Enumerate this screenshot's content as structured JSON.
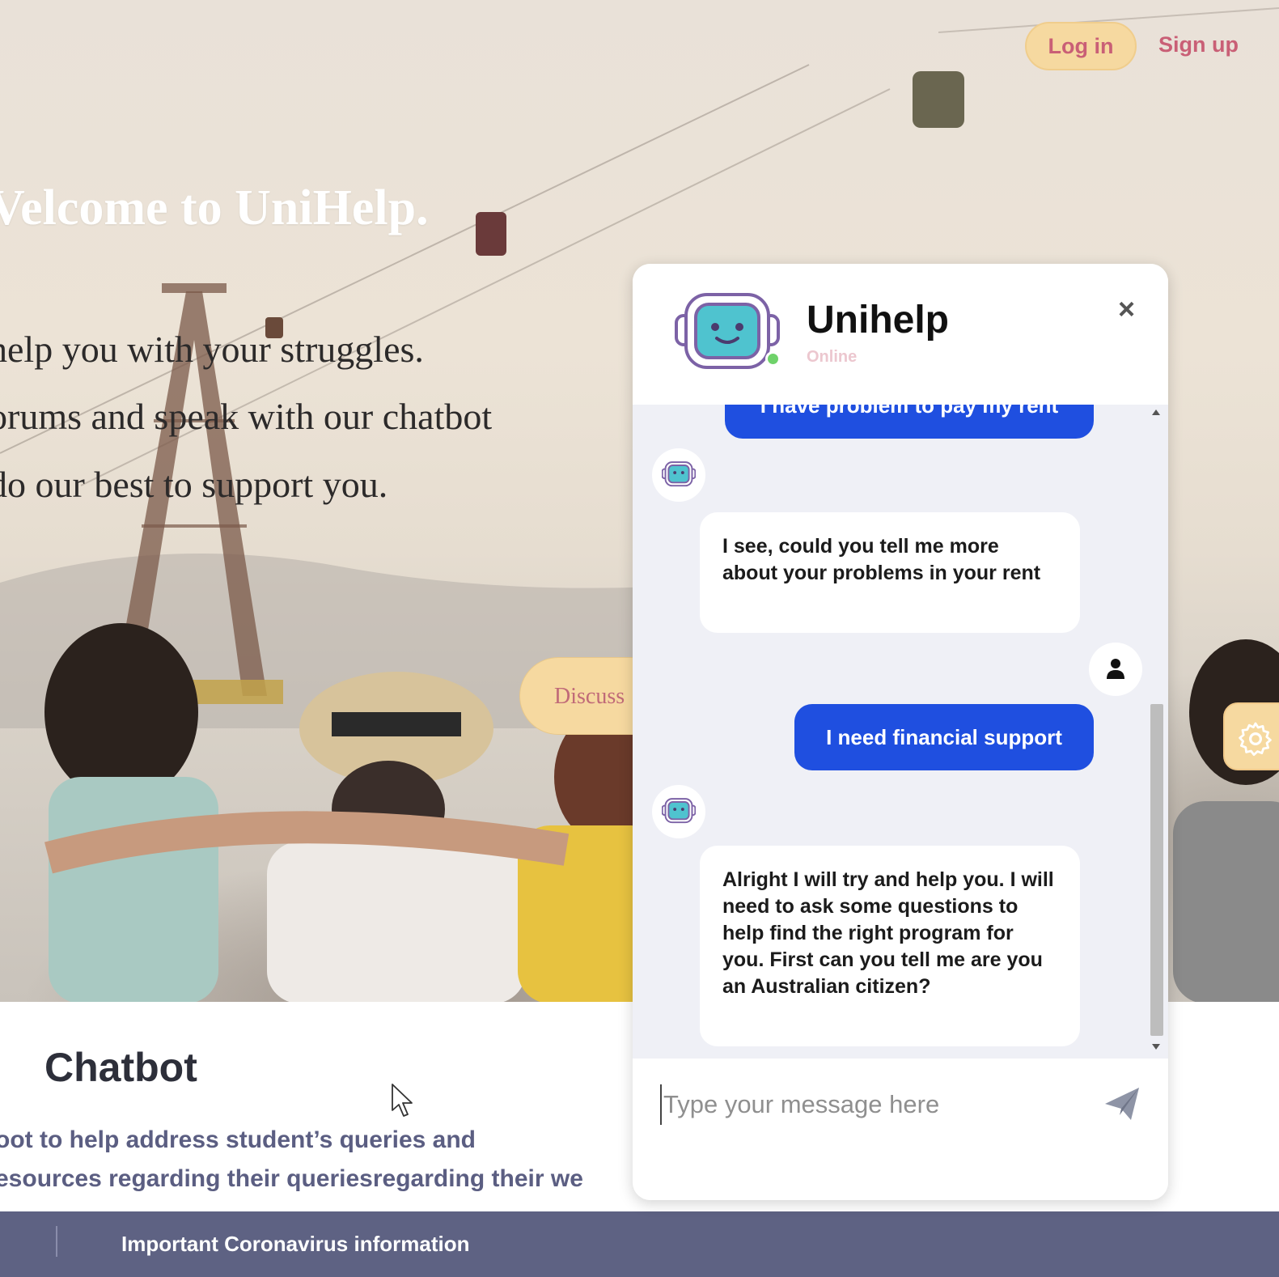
{
  "hero": {
    "title": "Velcome to UniHelp.",
    "line1": " help you with your struggles.",
    "line2": "orums and speak with our chatbot",
    "line3": " do our best to support you.",
    "discuss_label": "Discuss"
  },
  "nav": {
    "login_label": "Log in",
    "signup_label": "Sign up"
  },
  "section": {
    "title": "Chatbot",
    "text1": "oot to help address student’s queries and",
    "text2": "esources regarding their queriesregarding their we"
  },
  "footer": {
    "notice": "Important Coronavirus information"
  },
  "chat": {
    "name": "Unihelp",
    "status": "Online",
    "close_symbol": "×",
    "messages": {
      "user_prev": "I have problem to pay my rent",
      "bot1": "I see, could you tell me more about your problems in your rent",
      "user1": "I need financial support",
      "bot2": "Alright I will try and help you. I will need to ask some questions to help find the right program for you. First can you tell me are you an Australian citizen?"
    },
    "input_placeholder": "Type your message here"
  },
  "colors": {
    "accent_yellow": "#f6d9a0",
    "accent_pink": "#c95f76",
    "user_bubble": "#1f4fe0",
    "footer_bg": "#5e6283",
    "online_green": "#6fd26a"
  },
  "icons": {
    "bot": "robot-icon",
    "user": "user-icon",
    "send": "send-icon",
    "settings": "gear-icon",
    "close": "close-icon",
    "cursor": "cursor-icon"
  }
}
